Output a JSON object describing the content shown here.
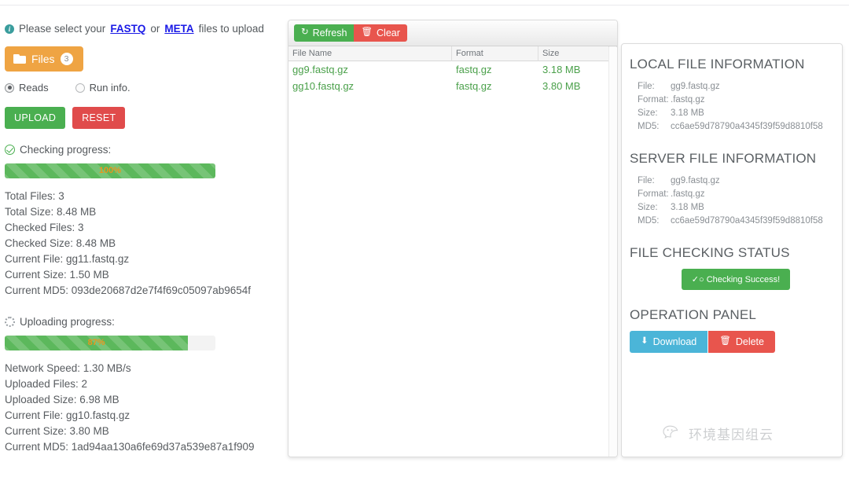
{
  "left": {
    "info": {
      "icon": "info-icon",
      "prefix": "Please select your ",
      "link1": "FASTQ",
      "middle": " or ",
      "link2": "META",
      "suffix": " files to upload"
    },
    "files_button": {
      "label": "Files",
      "count": "3",
      "icon": "folder-icon"
    },
    "radios": [
      {
        "label": "Reads",
        "selected": true
      },
      {
        "label": "Run info.",
        "selected": false
      }
    ],
    "upload_button": "UPLOAD",
    "reset_button": "RESET",
    "checking": {
      "heading": "Checking progress:",
      "icon": "check-circle-icon",
      "percent_label": "100%",
      "percent_value": 100,
      "stats": [
        "Total Files: 3",
        "Total Size: 8.48 MB",
        "Checked Files: 3",
        "Checked Size: 8.48 MB",
        "Current File: gg11.fastq.gz",
        "Current Size: 1.50 MB",
        "Current MD5: 093de20687d2e7f4f69c05097ab9654f"
      ]
    },
    "uploading": {
      "heading": "Uploading progress:",
      "icon": "spinner-icon",
      "percent_label": "87%",
      "percent_value": 87,
      "stats": [
        "Network Speed: 1.30 MB/s",
        "Uploaded Files: 2",
        "Uploaded Size: 6.98 MB",
        "Current File: gg10.fastq.gz",
        "Current Size: 3.80 MB",
        "Current MD5: 1ad94aa130a6fe69d37a539e87a1f909"
      ]
    }
  },
  "table": {
    "toolbar": {
      "refresh": {
        "label": "Refresh",
        "icon": "refresh-icon"
      },
      "clear": {
        "label": "Clear",
        "icon": "trash-icon"
      }
    },
    "columns": [
      "File Name",
      "Format",
      "Size"
    ],
    "rows": [
      {
        "name": "gg9.fastq.gz",
        "format": "fastq.gz",
        "size": "3.18 MB"
      },
      {
        "name": "gg10.fastq.gz",
        "format": "fastq.gz",
        "size": "3.80 MB"
      }
    ]
  },
  "details": {
    "local": {
      "title": "LOCAL FILE INFORMATION",
      "fields": [
        {
          "key": "File:",
          "value": "gg9.fastq.gz"
        },
        {
          "key": "Format:",
          "value": ".fastq.gz"
        },
        {
          "key": "Size:",
          "value": "3.18 MB"
        },
        {
          "key": "MD5:",
          "value": "cc6ae59d78790a4345f39f59d8810f58"
        }
      ]
    },
    "server": {
      "title": "SERVER FILE INFORMATION",
      "fields": [
        {
          "key": "File:",
          "value": "gg9.fastq.gz"
        },
        {
          "key": "Format:",
          "value": ".fastq.gz"
        },
        {
          "key": "Size:",
          "value": "3.18 MB"
        },
        {
          "key": "MD5:",
          "value": "cc6ae59d78790a4345f39f59d8810f58"
        }
      ]
    },
    "checking_status": {
      "title": "FILE CHECKING STATUS",
      "badge": "Checking Success!",
      "badge_icon": "check-circle-icon"
    },
    "operation": {
      "title": "OPERATION PANEL",
      "download": {
        "label": "Download",
        "icon": "download-icon"
      },
      "delete": {
        "label": "Delete",
        "icon": "trash-icon"
      }
    }
  },
  "watermark": {
    "text": "环境基因组云",
    "icon": "wechat-icon"
  },
  "colors": {
    "green": "#4aaf50",
    "red": "#e8554d",
    "orange": "#efa443",
    "blue": "#4bb5d8",
    "link": "#1a1ae6",
    "percent_text": "#e8951f"
  }
}
